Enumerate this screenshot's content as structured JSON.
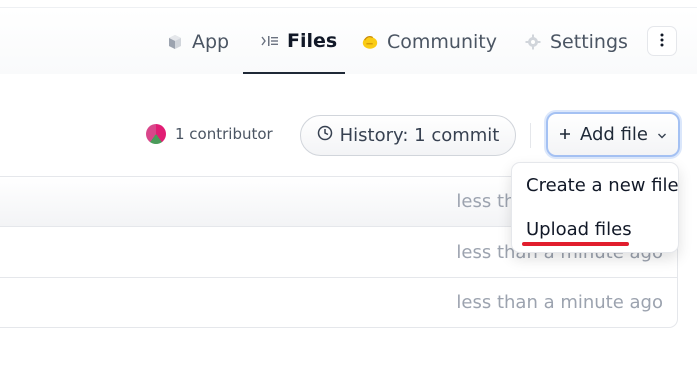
{
  "nav": {
    "tabs": [
      {
        "label": "App",
        "icon": "cube-icon"
      },
      {
        "label": "Files",
        "icon": "files-icon",
        "active": true
      },
      {
        "label": "Community",
        "icon": "clap-icon"
      },
      {
        "label": "Settings",
        "icon": "gear-icon"
      }
    ],
    "more_icon": "kebab-icon"
  },
  "toolbar": {
    "contributors": "1 contributor",
    "history": "History: 1 commit",
    "add_file": "+ Add file",
    "add_file_text": "Add file"
  },
  "table": {
    "rows": [
      {
        "updated": "less than a minute ago"
      },
      {
        "updated": "less than a minute ago"
      },
      {
        "updated": "less than a minute ago"
      }
    ]
  },
  "dropdown": {
    "items": [
      "Create a new file",
      "Upload files"
    ]
  },
  "colors": {
    "accent_border": "#a4c1f3",
    "annotation": "#e11d2d",
    "muted_text": "#9ca3af"
  }
}
